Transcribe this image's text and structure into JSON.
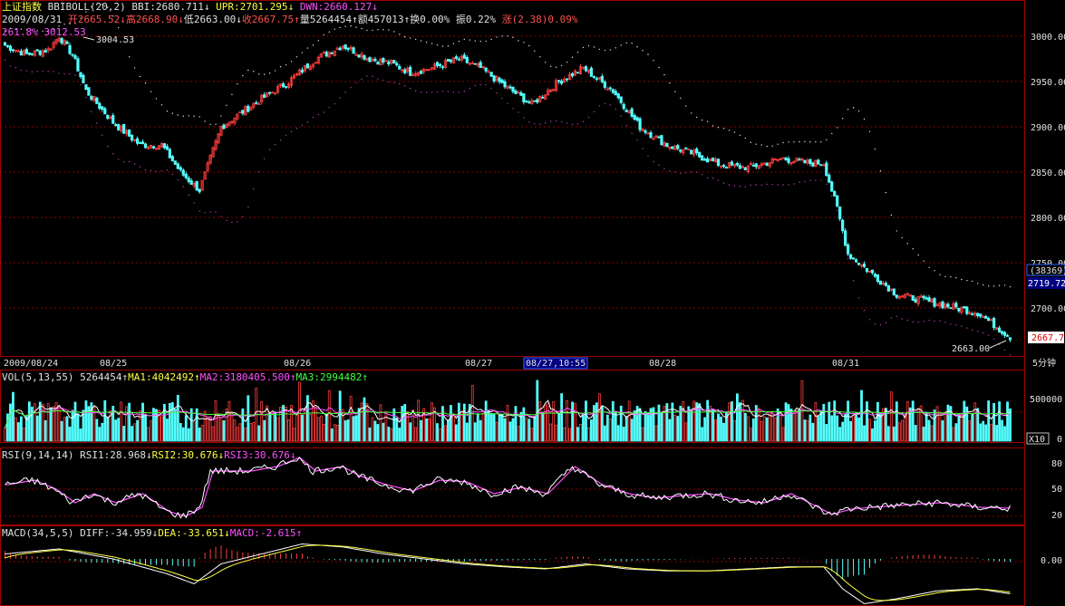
{
  "colors": {
    "up": "#ff3c3c",
    "down": "#54ffff",
    "grid": "#8b0000",
    "boll": "#c0c0c0",
    "upper": "#e0e0e0",
    "lower": "#b040b0",
    "ma1": "#ffffff",
    "ma2": "#ff50ff",
    "ma3": "#40ff40",
    "rsi1": "#ffffff",
    "rsi2": "#ffff40",
    "rsi3": "#ff50ff"
  },
  "header": {
    "index_name": "上证指数",
    "indicator": "BBIBOLL(20,2)",
    "bbi": "BBI:2680.711",
    "upr": "UPR:2701.295",
    "dwn": "DWN:2660.127",
    "date": "2009/08/31",
    "open": "开2665.52",
    "high": "高2668.90",
    "low": "低2663.00",
    "close": "收2667.75",
    "volume": "量5264454",
    "amount": "额457013",
    "turnover": "换0.00%",
    "amplitude": "振0.22%",
    "change": "涨(2.38)0.09%",
    "fib_note": "261.8% 3012.53",
    "peak_label": "3004.53",
    "low_label": "2663.00"
  },
  "axis": {
    "price_ticks": [
      "3000.00",
      "2950.00",
      "2900.00",
      "2850.00",
      "2800.00",
      "2750.00",
      "2700.00"
    ],
    "date_labels": [
      "2009/08/24",
      "08/25",
      "08/26",
      "08/27",
      "08/27,10:55",
      "08/28",
      "08/31"
    ],
    "period": "5分钟",
    "cursor_count": "(38369)",
    "cursor_price": "2719.72",
    "last_price": "2667.7",
    "vol_ticks": [
      "500000",
      "0"
    ],
    "vol_mult": "X10",
    "rsi_ticks": [
      "80",
      "50",
      "20"
    ],
    "macd_ticks": [
      "0.00"
    ]
  },
  "panels": {
    "vol_label": "VOL(5,13,55)",
    "vol_value": "5264454",
    "ma1": "MA1:4042492",
    "ma2": "MA2:3180405.500",
    "ma3": "MA3:2994482",
    "rsi_label": "RSI(9,14,14)",
    "rsi1": "RSI1:28.968",
    "rsi2": "RSI2:30.676",
    "rsi3": "RSI3:30.676",
    "macd_label": "MACD(34,5,5)",
    "diff": "DIFF:-34.959",
    "dea": "DEA:-33.651",
    "macd": "MACD:-2.615"
  },
  "chart_data": {
    "type": "candlestick",
    "interval": "5分钟",
    "days": [
      "08/24",
      "08/25",
      "08/26",
      "08/27",
      "08/28",
      "08/31"
    ],
    "bars_per_day": 48,
    "price_keypoints": [
      [
        0,
        2990
      ],
      [
        8,
        2980
      ],
      [
        16,
        2985
      ],
      [
        20,
        3000
      ],
      [
        25,
        2980
      ],
      [
        30,
        2940
      ],
      [
        40,
        2905
      ],
      [
        50,
        2880
      ],
      [
        58,
        2880
      ],
      [
        65,
        2850
      ],
      [
        72,
        2830
      ],
      [
        80,
        2900
      ],
      [
        92,
        2925
      ],
      [
        105,
        2950
      ],
      [
        115,
        2975
      ],
      [
        125,
        2990
      ],
      [
        135,
        2975
      ],
      [
        143,
        2970
      ],
      [
        150,
        2960
      ],
      [
        158,
        2965
      ],
      [
        168,
        2975
      ],
      [
        176,
        2965
      ],
      [
        185,
        2945
      ],
      [
        195,
        2925
      ],
      [
        205,
        2950
      ],
      [
        214,
        2965
      ],
      [
        225,
        2940
      ],
      [
        235,
        2900
      ],
      [
        245,
        2880
      ],
      [
        255,
        2870
      ],
      [
        265,
        2858
      ],
      [
        275,
        2855
      ],
      [
        288,
        2865
      ],
      [
        297,
        2860
      ],
      [
        303,
        2860
      ],
      [
        308,
        2810
      ],
      [
        312,
        2760
      ],
      [
        320,
        2740
      ],
      [
        330,
        2715
      ],
      [
        345,
        2705
      ],
      [
        360,
        2695
      ],
      [
        372,
        2668
      ]
    ],
    "rsi_keypoints": [
      [
        0,
        55
      ],
      [
        10,
        60
      ],
      [
        18,
        50
      ],
      [
        25,
        35
      ],
      [
        32,
        45
      ],
      [
        40,
        35
      ],
      [
        50,
        45
      ],
      [
        60,
        25
      ],
      [
        66,
        20
      ],
      [
        72,
        30
      ],
      [
        76,
        70
      ],
      [
        90,
        70
      ],
      [
        100,
        75
      ],
      [
        108,
        85
      ],
      [
        114,
        70
      ],
      [
        124,
        75
      ],
      [
        130,
        65
      ],
      [
        140,
        55
      ],
      [
        150,
        48
      ],
      [
        160,
        60
      ],
      [
        170,
        58
      ],
      [
        180,
        45
      ],
      [
        190,
        52
      ],
      [
        200,
        45
      ],
      [
        210,
        75
      ],
      [
        220,
        55
      ],
      [
        230,
        45
      ],
      [
        240,
        40
      ],
      [
        250,
        43
      ],
      [
        260,
        45
      ],
      [
        270,
        38
      ],
      [
        280,
        35
      ],
      [
        290,
        45
      ],
      [
        300,
        30
      ],
      [
        305,
        22
      ],
      [
        312,
        28
      ],
      [
        320,
        30
      ],
      [
        330,
        32
      ],
      [
        345,
        35
      ],
      [
        360,
        30
      ],
      [
        372,
        29
      ]
    ],
    "diff_keypoints": [
      [
        0,
        5
      ],
      [
        20,
        10
      ],
      [
        40,
        0
      ],
      [
        60,
        -15
      ],
      [
        70,
        -25
      ],
      [
        80,
        -5
      ],
      [
        95,
        5
      ],
      [
        110,
        15
      ],
      [
        125,
        12
      ],
      [
        140,
        5
      ],
      [
        155,
        0
      ],
      [
        170,
        -5
      ],
      [
        185,
        -8
      ],
      [
        200,
        -10
      ],
      [
        215,
        -5
      ],
      [
        230,
        -10
      ],
      [
        245,
        -12
      ],
      [
        260,
        -12
      ],
      [
        275,
        -10
      ],
      [
        290,
        -8
      ],
      [
        303,
        -8
      ],
      [
        310,
        -30
      ],
      [
        318,
        -45
      ],
      [
        330,
        -40
      ],
      [
        345,
        -32
      ],
      [
        360,
        -30
      ],
      [
        372,
        -35
      ]
    ],
    "last": {
      "open": 2665.52,
      "high": 2668.9,
      "low": 2663.0,
      "close": 2667.75,
      "volume": 5264454
    },
    "bbiboll": {
      "bbi": 2680.711,
      "upr": 2701.295,
      "dwn": 2660.127
    },
    "rsi": {
      "rsi1": 28.968,
      "rsi2": 30.676,
      "rsi3": 30.676
    },
    "macd": {
      "diff": -34.959,
      "dea": -33.651,
      "macd": -2.615
    },
    "price_range": [
      2650,
      3020
    ]
  }
}
